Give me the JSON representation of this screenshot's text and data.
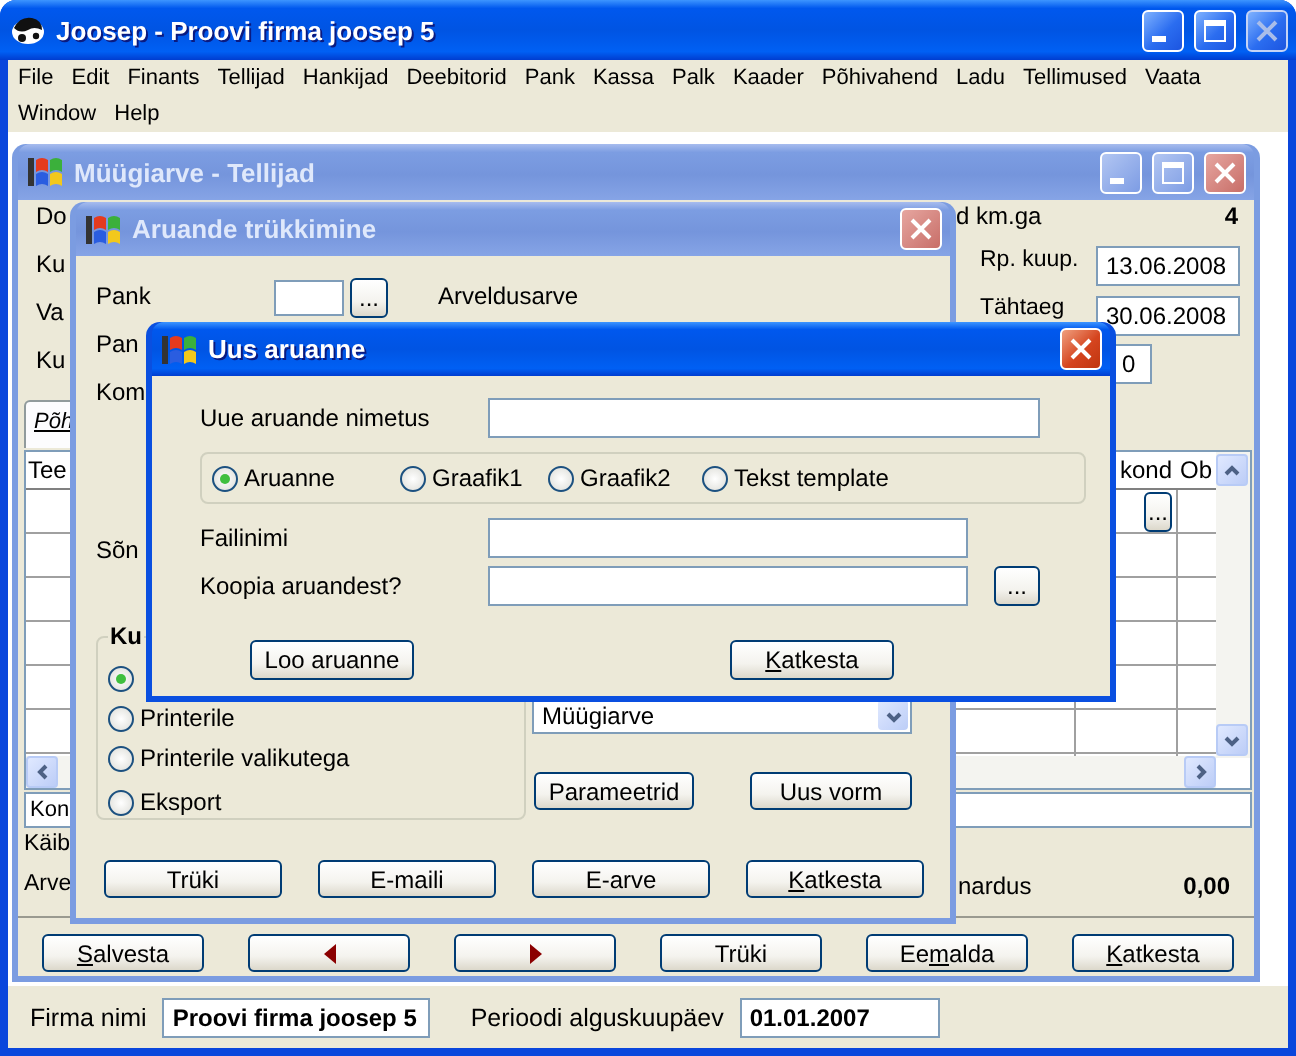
{
  "window": {
    "title": "Joosep - Proovi firma joosep 5",
    "active": true,
    "close_disabled": true
  },
  "menu_rows": [
    {
      "items": [
        "File",
        "Edit",
        "Finants",
        "Tellijad",
        "Hankijad",
        "Deebitorid",
        "Pank",
        "Kassa",
        "Palk",
        "Kaader",
        "Põhivahend",
        "Ladu",
        "Tellimused",
        "Vaata"
      ]
    },
    {
      "items": [
        "Window",
        "Help"
      ]
    }
  ],
  "invoice_window": {
    "title": "Müügiarve - Tellijad",
    "active": false,
    "left_labels": [
      "Do",
      "Ku",
      "Va",
      "Ku"
    ],
    "summary_label": "d km.ga",
    "summary_value": "4",
    "date_fields": [
      {
        "label": "Rp. kuup.",
        "value": "13.06.2008"
      },
      {
        "label": "Tähtaeg",
        "value": "30.06.2008"
      }
    ],
    "small_field": {
      "value": "0"
    },
    "tabs": [
      {
        "label": "Põh",
        "selected": true
      }
    ],
    "grid": {
      "columns": [
        "Tee",
        "kond",
        "Ob"
      ],
      "row_button": "..."
    },
    "comment_field": {
      "label": "Kon"
    },
    "bottom_labels": [
      "Käib",
      "Arve"
    ],
    "total": {
      "label": "nardus",
      "value": "0,00"
    },
    "buttons": [
      {
        "kind": "text",
        "label_parts": [
          {
            "text": "S",
            "underlined": true
          },
          {
            "text": "alvesta",
            "underlined": false
          }
        ]
      },
      {
        "kind": "previous"
      },
      {
        "kind": "next"
      },
      {
        "kind": "text",
        "label": "Trüki"
      },
      {
        "kind": "text",
        "label_parts": [
          {
            "text": "Ee",
            "underlined": false
          },
          {
            "text": "m",
            "underlined": true
          },
          {
            "text": "alda",
            "underlined": false
          }
        ]
      },
      {
        "kind": "text",
        "label_parts": [
          {
            "text": "K",
            "underlined": true
          },
          {
            "text": "atkesta",
            "underlined": false
          }
        ]
      }
    ]
  },
  "print_window": {
    "title": "Aruande trükkimine",
    "active": false,
    "bank": {
      "label": "Pank",
      "button": "..."
    },
    "account_label": "Arveldusarve",
    "labels": [
      "Pan",
      "Kom"
    ],
    "lower_label": "Sõn",
    "output_group": {
      "title": "Ku",
      "options": [
        {
          "selected": true
        },
        {
          "label": "Printerile",
          "selected": false
        },
        {
          "label": "Printerile valikutega",
          "selected": false
        },
        {
          "label": "Eksport",
          "selected": false
        }
      ]
    },
    "form_select": {
      "value": "Müügiarve"
    },
    "form_buttons": [
      "Parameetrid",
      "Uus vorm"
    ],
    "buttons": [
      {
        "label": "Trüki"
      },
      {
        "label": "E-maili"
      },
      {
        "label": "E-arve"
      },
      {
        "label_parts": [
          {
            "text": "K",
            "underlined": true
          },
          {
            "text": "atkesta",
            "underlined": false
          }
        ]
      }
    ]
  },
  "new_report_dialog": {
    "title": "Uus aruanne",
    "active": true,
    "name_label": "Uue aruande nimetus",
    "types": [
      {
        "label": "Aruanne",
        "selected": true
      },
      {
        "label": "Graafik1",
        "selected": false
      },
      {
        "label": "Graafik2",
        "selected": false
      },
      {
        "label": "Tekst template",
        "selected": false
      }
    ],
    "file_label": "Failinimi",
    "copy_label": "Koopia aruandest?",
    "copy_button": "...",
    "buttons": [
      {
        "label": "Loo aruanne"
      },
      {
        "label_parts": [
          {
            "text": "K",
            "underlined": true
          },
          {
            "text": "atkesta",
            "underlined": false
          }
        ]
      }
    ]
  },
  "status_bar": {
    "items": [
      {
        "label": "Firma nimi",
        "value": "Proovi firma joosep 5"
      },
      {
        "label": "Perioodi alguskuupäev",
        "value": "01.01.2007"
      }
    ]
  }
}
